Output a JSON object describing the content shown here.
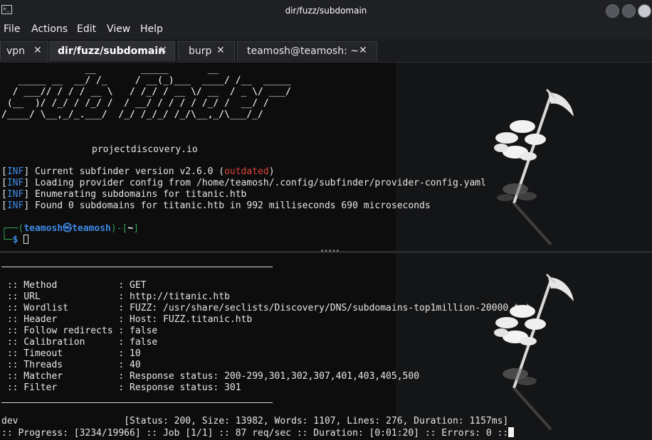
{
  "window": {
    "title": "dir/fuzz/subdomain"
  },
  "menu": [
    "File",
    "Actions",
    "Edit",
    "View",
    "Help"
  ],
  "tabs": [
    {
      "label": "vpn",
      "active": false
    },
    {
      "label": "dir/fuzz/subdomain",
      "active": true
    },
    {
      "label": "burp",
      "active": false
    },
    {
      "label": "teamosh@teamosh: ~",
      "active": false
    }
  ],
  "tab_close_glyph": "✕",
  "top_pane": {
    "banner": [
      "               __        _____       __           ",
      "   _____ __  __/ /_     / __(_)___  ____/ /__  _____",
      "  / ___// / / / __ \\   / /_/ / __ \\/ __  / _ \\/ ___/",
      " (__  )/ /_/ / /_/ /  / __/ / / / / /_/ /  __/ /    ",
      "/____/ \\__,_/_.___/  /_/ /_/_/ /_/\\__,_/\\___/_/     "
    ],
    "brand": "projectdiscovery.io",
    "log_tag": "INF",
    "logs": [
      {
        "text": "Current subfinder version v2.6.0 (",
        "highlight": "outdated",
        "tail": ")"
      },
      {
        "text": "Loading provider config from /home/teamosh/.config/subfinder/provider-config.yaml"
      },
      {
        "text": "Enumerating subdomains for titanic.htb"
      },
      {
        "text": "Found 0 subdomains for titanic.htb in 992 milliseconds 690 microseconds"
      }
    ],
    "prompt": {
      "frame_open": "┌──(",
      "user": "teamosh㉿teamosh",
      "frame_mid": ")-[",
      "dir": "~",
      "frame_close": "]",
      "second_frame": "└─",
      "dollar": "$"
    }
  },
  "bottom_pane": {
    "config": [
      {
        "key": " :: Method           ",
        "value": ": GET"
      },
      {
        "key": " :: URL              ",
        "value": ": http://titanic.htb"
      },
      {
        "key": " :: Wordlist         ",
        "value": ": FUZZ: /usr/share/seclists/Discovery/DNS/subdomains-top1million-20000.txt"
      },
      {
        "key": " :: Header           ",
        "value": ": Host: FUZZ.titanic.htb"
      },
      {
        "key": " :: Follow redirects ",
        "value": ": false"
      },
      {
        "key": " :: Calibration      ",
        "value": ": false"
      },
      {
        "key": " :: Timeout          ",
        "value": ": 10"
      },
      {
        "key": " :: Threads          ",
        "value": ": 40"
      },
      {
        "key": " :: Matcher          ",
        "value": ": Response status: 200-299,301,302,307,401,403,405,500"
      },
      {
        "key": " :: Filter           ",
        "value": ": Response status: 301"
      }
    ],
    "result": {
      "name": "dev",
      "status_line": "                   [Status: 200, Size: 13982, Words: 1107, Lines: 276, Duration: 1157ms]"
    },
    "progress_line": ":: Progress: [3234/19966] :: Job [1/1] :: 87 req/sec :: Duration: [0:01:20] :: Errors: 0 ::"
  },
  "colors": {
    "background": "#0d0d0d",
    "info_tag": "#3f8ae6",
    "outdated": "#e0433c",
    "prompt_frame": "#2f9e4f"
  },
  "icons": [
    "terminal-app-icon",
    "minimize-icon",
    "maximize-icon",
    "close-icon",
    "reaper-art-icon"
  ]
}
